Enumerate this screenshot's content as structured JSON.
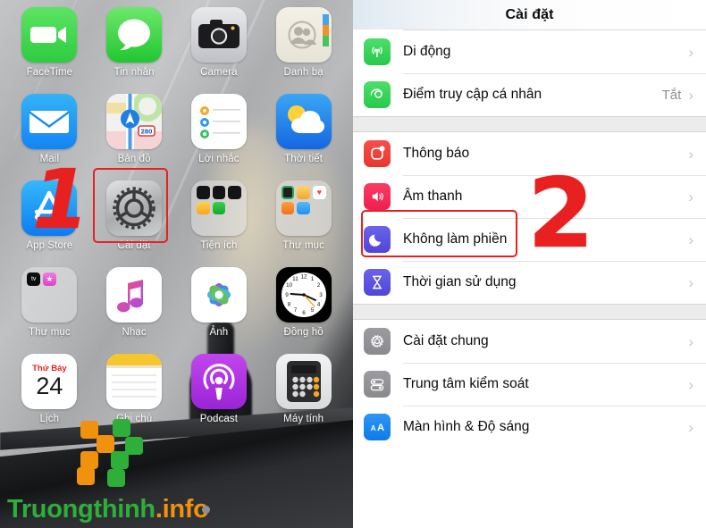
{
  "home": {
    "apps": [
      {
        "label": "FaceTime",
        "icon": "facetime-icon"
      },
      {
        "label": "Tin nhắn",
        "icon": "messages-icon"
      },
      {
        "label": "Camera",
        "icon": "camera-icon"
      },
      {
        "label": "Danh bạ",
        "icon": "contacts-icon"
      },
      {
        "label": "Mail",
        "icon": "mail-icon"
      },
      {
        "label": "Bản đồ",
        "icon": "maps-icon"
      },
      {
        "label": "Lời nhắc",
        "icon": "reminders-icon"
      },
      {
        "label": "Thời tiết",
        "icon": "weather-icon"
      },
      {
        "label": "App Store",
        "icon": "app-store-icon"
      },
      {
        "label": "Cài đặt",
        "icon": "settings-gear-icon"
      },
      {
        "label": "Tiện ích",
        "icon": "folder-icon"
      },
      {
        "label": "Thư mục",
        "icon": "folder-icon"
      },
      {
        "label": "Thư mục",
        "icon": "folder-icon"
      },
      {
        "label": "Nhạc",
        "icon": "music-icon"
      },
      {
        "label": "Ảnh",
        "icon": "photos-icon"
      },
      {
        "label": "Đồng hồ",
        "icon": "clock-icon"
      },
      {
        "label": "Lịch",
        "icon": "calendar-icon"
      },
      {
        "label": "Ghi chú",
        "icon": "notes-icon"
      },
      {
        "label": "Podcast",
        "icon": "podcast-icon"
      },
      {
        "label": "Máy tính",
        "icon": "calculator-icon"
      }
    ],
    "calendar_weekday": "Thứ Bảy",
    "calendar_day": "24",
    "clock_numerals": [
      "12",
      "1",
      "2",
      "3",
      "4",
      "5",
      "6",
      "7",
      "8",
      "9",
      "10",
      "11"
    ],
    "maps_shield_number": "280",
    "annotation_step1": "1",
    "watermark": {
      "part1": "Truongthinh",
      "part2": ".",
      "part3": "info",
      "color_green": "#2fae3a",
      "color_orange": "#f0920e"
    }
  },
  "settings": {
    "title": "Cài đặt",
    "annotation_step2": "2",
    "highlight_color": "#e8201f",
    "chevron": "›",
    "groups": [
      {
        "rows": [
          {
            "label": "Di động",
            "icon": "cellular-icon",
            "value": ""
          },
          {
            "label": "Điểm truy cập cá nhân",
            "icon": "hotspot-icon",
            "value": "Tắt"
          }
        ]
      },
      {
        "rows": [
          {
            "label": "Thông báo",
            "icon": "notifications-icon",
            "value": ""
          },
          {
            "label": "Âm thanh",
            "icon": "sounds-icon",
            "value": ""
          },
          {
            "label": "Không làm phiền",
            "icon": "do-not-disturb-icon",
            "value": ""
          },
          {
            "label": "Thời gian sử dụng",
            "icon": "screen-time-icon",
            "value": ""
          }
        ]
      },
      {
        "rows": [
          {
            "label": "Cài đặt chung",
            "icon": "general-gear-icon",
            "value": ""
          },
          {
            "label": "Trung tâm kiểm soát",
            "icon": "control-center-icon",
            "value": ""
          },
          {
            "label": "Màn hình & Độ sáng",
            "icon": "display-brightness-icon",
            "value": ""
          }
        ]
      }
    ]
  }
}
